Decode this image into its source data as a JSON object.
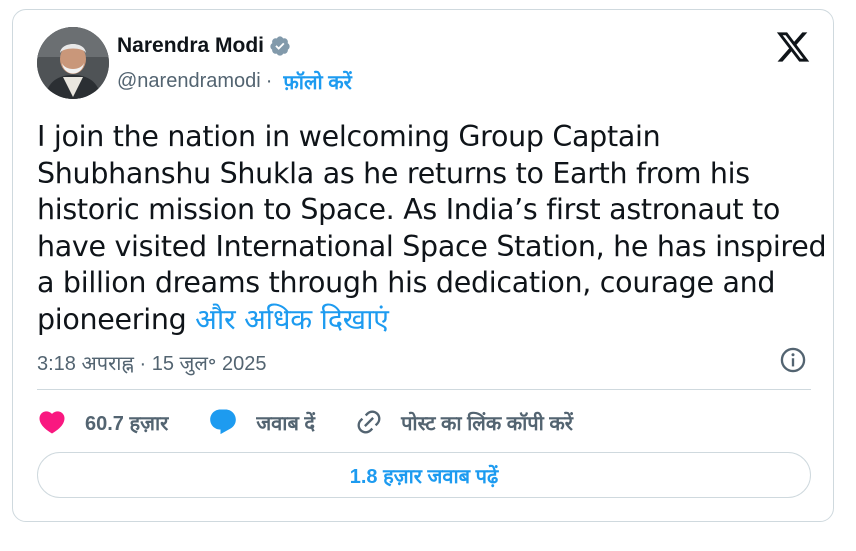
{
  "author": {
    "name": "Narendra Modi",
    "handle": "@narendramodi",
    "follow_label": "फ़ॉलो करें",
    "separator": "·"
  },
  "tweet": {
    "text": "I join the nation in welcoming Group Captain Shubhanshu Shukla as he returns to Earth from his historic mission to Space. As India’s first astronaut to have visited International Space Station, he has inspired a billion dreams through his dedication, courage and pioneering ",
    "show_more": "और अधिक दिखाएं",
    "timestamp": "3:18 अपराह्न · 15 जुल॰ 2025"
  },
  "actions": {
    "likes": "60.7 हज़ार",
    "reply_label": "जवाब दें",
    "copy_link_label": "पोस्ट का लिंक कॉपी करें"
  },
  "read_replies_label": "1.8 हज़ार जवाब पढ़ें",
  "colors": {
    "accent": "#1d9bf0",
    "like": "#f91880",
    "muted": "#536471",
    "border": "#cfd9de"
  },
  "icons": [
    "verified-badge-icon",
    "x-logo-icon",
    "info-icon",
    "heart-icon",
    "reply-bubble-icon",
    "link-icon"
  ]
}
